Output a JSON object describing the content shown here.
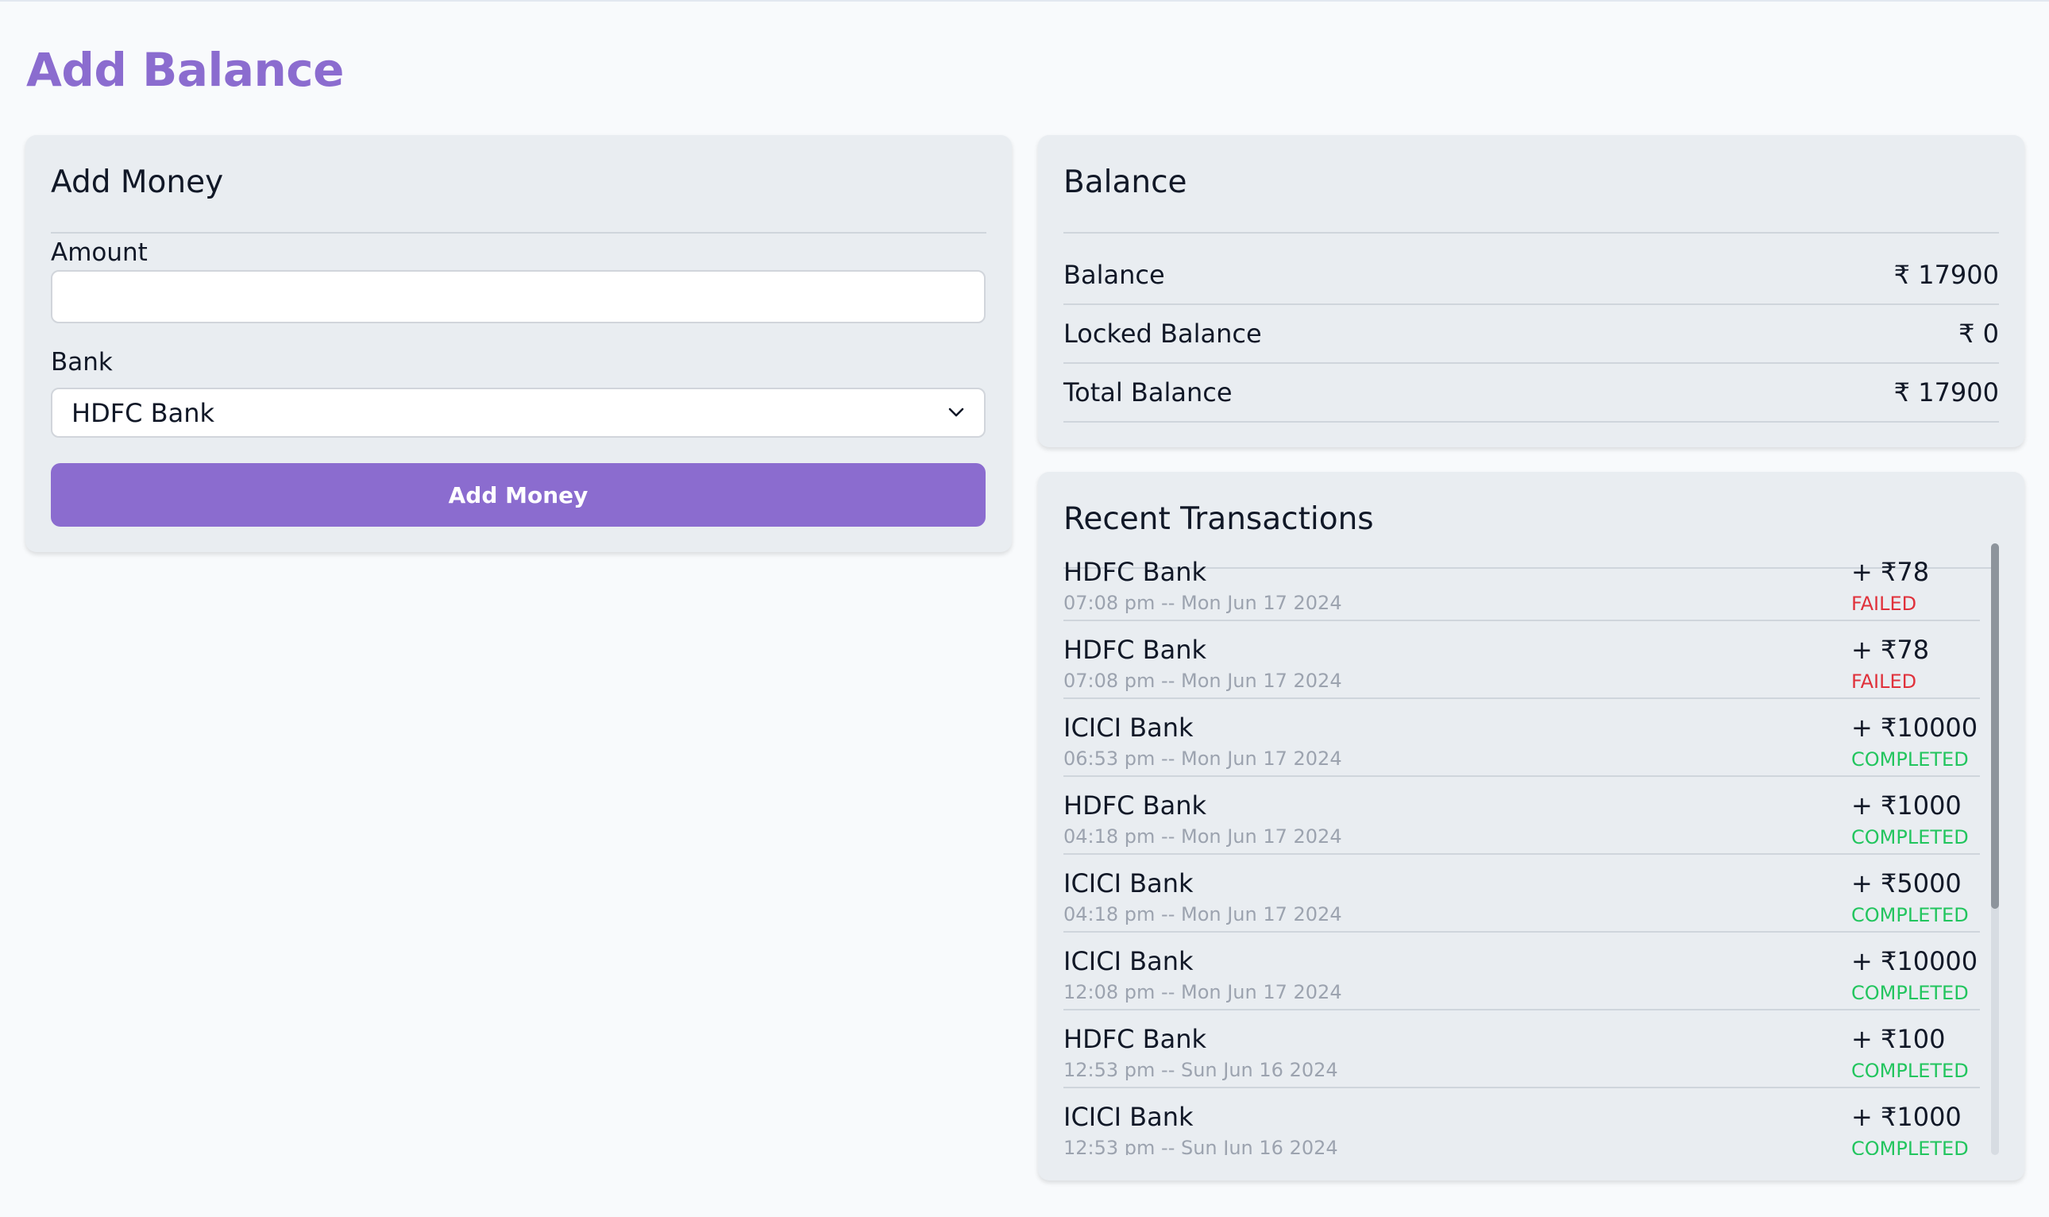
{
  "page": {
    "title": "Add Balance"
  },
  "add_money": {
    "heading": "Add Money",
    "amount_label": "Amount",
    "amount_value": "",
    "bank_label": "Bank",
    "bank_selected": "HDFC Bank",
    "button_label": "Add Money"
  },
  "balance": {
    "heading": "Balance",
    "rows": [
      {
        "label": "Balance",
        "value": "₹ 17900"
      },
      {
        "label": "Locked Balance",
        "value": "₹ 0"
      },
      {
        "label": "Total Balance",
        "value": "₹ 17900"
      }
    ]
  },
  "recent": {
    "heading": "Recent Transactions",
    "transactions": [
      {
        "bank": "HDFC Bank",
        "time": "07:08 pm -- Mon Jun 17 2024",
        "amount": "+ ₹78",
        "status": "FAILED"
      },
      {
        "bank": "HDFC Bank",
        "time": "07:08 pm -- Mon Jun 17 2024",
        "amount": "+ ₹78",
        "status": "FAILED"
      },
      {
        "bank": "ICICI Bank",
        "time": "06:53 pm -- Mon Jun 17 2024",
        "amount": "+ ₹10000",
        "status": "COMPLETED"
      },
      {
        "bank": "HDFC Bank",
        "time": "04:18 pm -- Mon Jun 17 2024",
        "amount": "+ ₹1000",
        "status": "COMPLETED"
      },
      {
        "bank": "ICICI Bank",
        "time": "04:18 pm -- Mon Jun 17 2024",
        "amount": "+ ₹5000",
        "status": "COMPLETED"
      },
      {
        "bank": "ICICI Bank",
        "time": "12:08 pm -- Mon Jun 17 2024",
        "amount": "+ ₹10000",
        "status": "COMPLETED"
      },
      {
        "bank": "HDFC Bank",
        "time": "12:53 pm -- Sun Jun 16 2024",
        "amount": "+ ₹100",
        "status": "COMPLETED"
      },
      {
        "bank": "ICICI Bank",
        "time": "12:53 pm -- Sun Jun 16 2024",
        "amount": "+ ₹1000",
        "status": "COMPLETED"
      }
    ]
  },
  "colors": {
    "accent": "#8b6ccf",
    "failed": "#e0313b",
    "completed": "#22c55e"
  },
  "icons": {
    "select_chevron": "chevron-down-icon"
  }
}
